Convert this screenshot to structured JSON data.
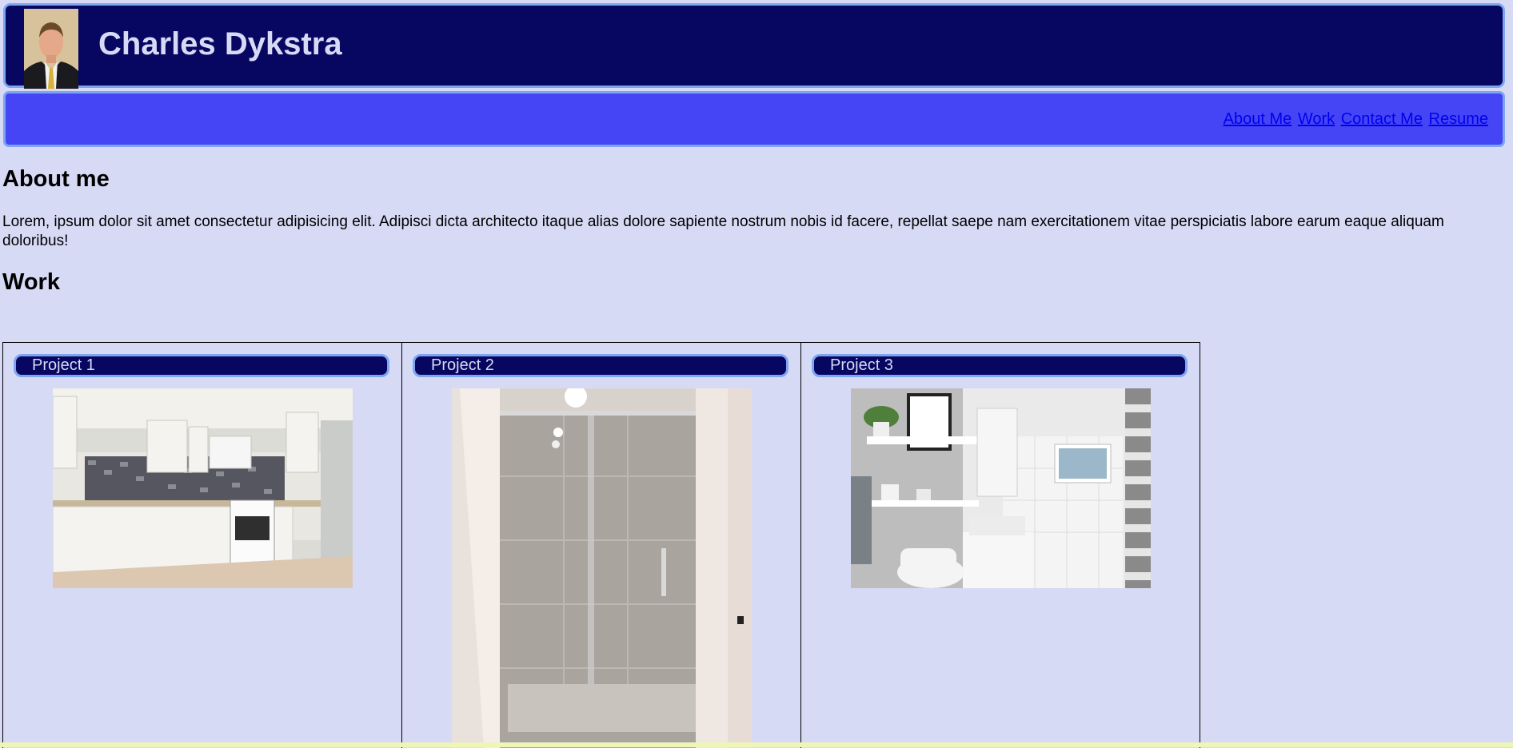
{
  "header": {
    "name": "Charles Dykstra",
    "avatar_alt": "Portrait of Charles Dykstra"
  },
  "nav": {
    "links": [
      "About Me",
      "Work",
      "Contact Me",
      "Resume"
    ]
  },
  "about": {
    "heading": "About me",
    "text": "Lorem, ipsum dolor sit amet consectetur adipisicing elit. Adipisci dicta architecto itaque alias dolore sapiente nostrum nobis id facere, repellat saepe nam exercitationem vitae perspiciatis labore earum eaque aliquam doloribus!"
  },
  "work": {
    "heading": "Work",
    "projects": [
      {
        "title": "Project 1",
        "photo": "kitchen-photo"
      },
      {
        "title": "Project 2",
        "photo": "shower-photo"
      },
      {
        "title": "Project 3",
        "photo": "bathroom-photo"
      }
    ]
  },
  "colors": {
    "page_background": "#d7daf5",
    "header_background": "#070661",
    "nav_background": "#4545f5",
    "border_accent": "#7ea6f0",
    "link": "#0000ee"
  }
}
